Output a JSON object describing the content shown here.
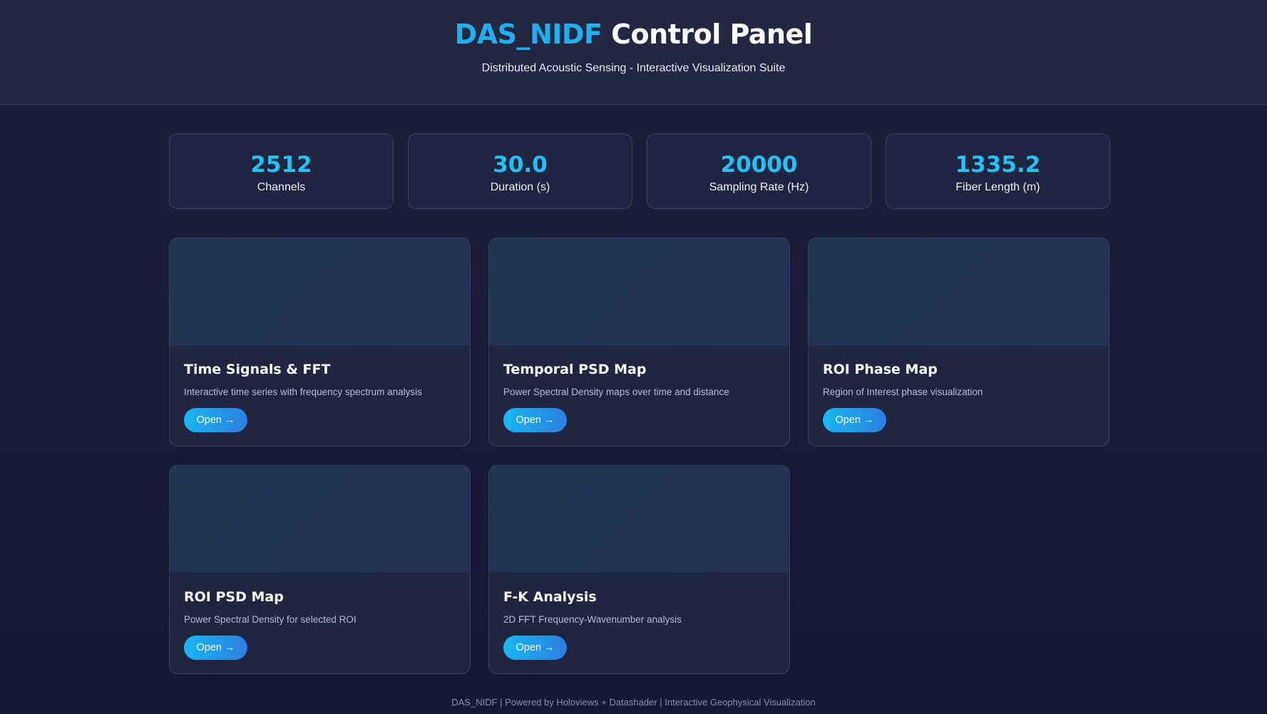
{
  "header": {
    "title_brand": "DAS_NIDF",
    "title_rest": " Control Panel",
    "subtitle": "Distributed Acoustic Sensing - Interactive Visualization Suite"
  },
  "stats": [
    {
      "value": "2512",
      "label": "Channels"
    },
    {
      "value": "30.0",
      "label": "Duration (s)"
    },
    {
      "value": "20000",
      "label": "Sampling Rate (Hz)"
    },
    {
      "value": "1335.2",
      "label": "Fiber Length (m)"
    }
  ],
  "cards": [
    {
      "title": "Time Signals & FFT",
      "description": "Interactive time series with frequency spectrum analysis",
      "button": "Open →"
    },
    {
      "title": "Temporal PSD Map",
      "description": "Power Spectral Density maps over time and distance",
      "button": "Open →"
    },
    {
      "title": "ROI Phase Map",
      "description": "Region of Interest phase visualization",
      "button": "Open →"
    },
    {
      "title": "ROI PSD Map",
      "description": "Power Spectral Density for selected ROI",
      "button": "Open →"
    },
    {
      "title": "F-K Analysis",
      "description": "2D FFT Frequency-Wavenumber analysis",
      "button": "Open →"
    }
  ],
  "footer": "DAS_NIDF | Powered by Holoviews + Datashader | Interactive Geophysical Visualization",
  "colors": {
    "accent": "#1ec4f7",
    "brand": "#1fb0ef",
    "button_start": "#17b8f2",
    "button_end": "#2c7ee0",
    "background": "#171c37"
  }
}
